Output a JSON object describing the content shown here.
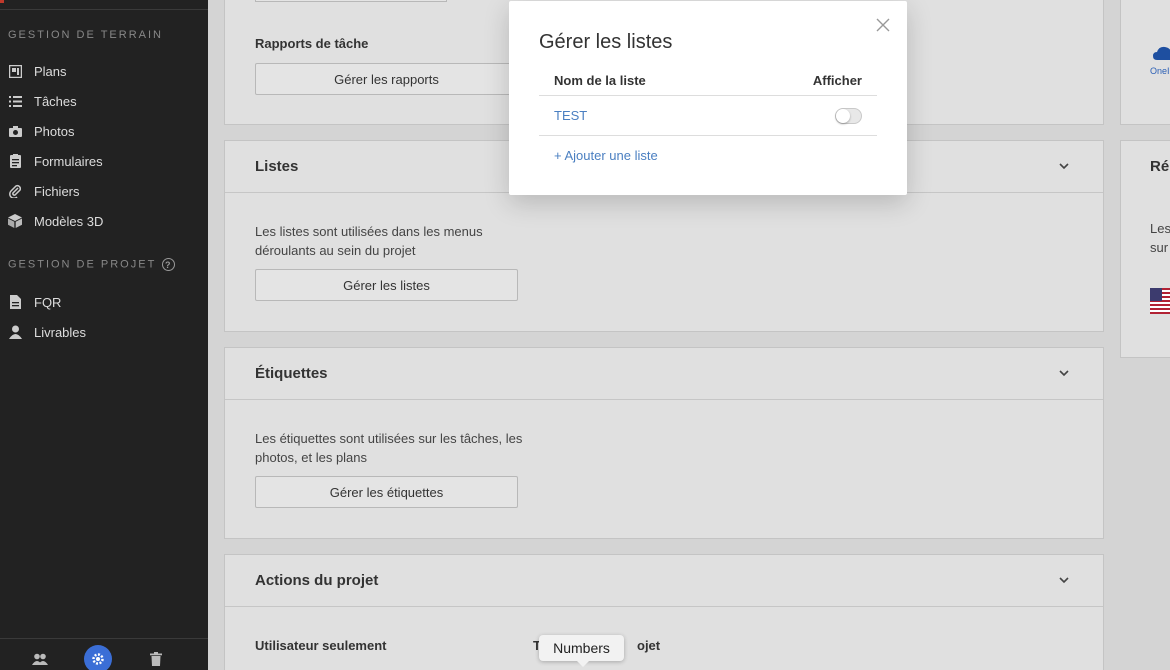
{
  "sidebar": {
    "section_field": "GESTION DE TERRAIN",
    "field_items": [
      {
        "label": "Plans",
        "icon": "plans-icon"
      },
      {
        "label": "Tâches",
        "icon": "list-icon"
      },
      {
        "label": "Photos",
        "icon": "camera-icon"
      },
      {
        "label": "Formulaires",
        "icon": "clipboard-icon"
      },
      {
        "label": "Fichiers",
        "icon": "paperclip-icon"
      },
      {
        "label": "Modèles 3D",
        "icon": "cube-icon"
      }
    ],
    "section_project": "GESTION DE PROJET",
    "project_items": [
      {
        "label": "FQR",
        "icon": "document-icon"
      },
      {
        "label": "Livrables",
        "icon": "user-icon"
      }
    ]
  },
  "main": {
    "rapports": {
      "label": "Rapports de tâche",
      "button": "Gérer les rapports"
    },
    "listes": {
      "title": "Listes",
      "desc": "Les listes sont utilisées dans les menus déroulants au sein du projet",
      "button": "Gérer les listes"
    },
    "etiquettes": {
      "title": "Étiquettes",
      "desc": "Les étiquettes sont utilisées sur les tâches, les photos, et les plans",
      "button": "Gérer les étiquettes"
    },
    "actions": {
      "title": "Actions du projet",
      "sub_left": "Utilisateur seulement",
      "sub_right_start": "T",
      "sub_right_end": "ojet"
    }
  },
  "right_panel": {
    "onedrive_fragment": "OneI",
    "title_fragment": "Rép",
    "text_line1": "Les",
    "text_line2": "sur"
  },
  "modal": {
    "title": "Gérer les listes",
    "col_name": "Nom de la liste",
    "col_show": "Afficher",
    "rows": [
      {
        "name": "TEST",
        "shown": false
      }
    ],
    "add_link": "+ Ajouter une liste"
  },
  "tooltip": {
    "text": "Numbers"
  },
  "colors": {
    "accent": "#4a7fc1",
    "sidebar_bg": "#222222",
    "active": "#3b6ed6"
  }
}
